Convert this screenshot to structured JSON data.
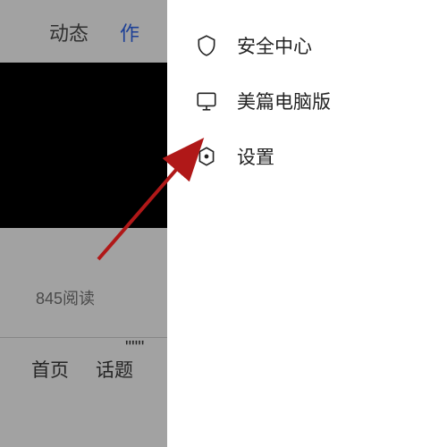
{
  "background": {
    "tabs": {
      "dynamic": "动态",
      "works_partial": "作"
    },
    "read_count": "845阅读",
    "partial_text": "\"\"\"",
    "bottom_nav": {
      "home": "首页",
      "topic": "话题"
    }
  },
  "menu": {
    "items": [
      {
        "icon": "shield-icon",
        "label": "安全中心"
      },
      {
        "icon": "monitor-icon",
        "label": "美篇电脑版"
      },
      {
        "icon": "settings-icon",
        "label": "设置"
      }
    ]
  },
  "annotation": {
    "arrow_color": "#b01818"
  }
}
